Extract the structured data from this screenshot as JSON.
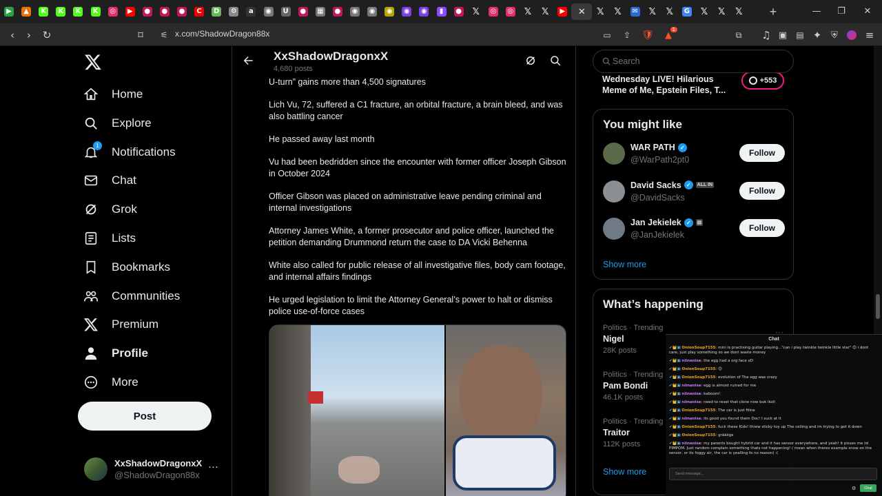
{
  "browser": {
    "url": "x.com/ShadowDragon88x",
    "tabs": [
      {
        "name": "tab-play",
        "glyph": "▶",
        "color": "#2ea043"
      },
      {
        "name": "tab-drive",
        "glyph": "▲",
        "color": "#e8710a"
      },
      {
        "name": "tab-kick-1",
        "glyph": "K",
        "color": "#53fc18"
      },
      {
        "name": "tab-kick-2",
        "glyph": "K",
        "color": "#53fc18"
      },
      {
        "name": "tab-kick-3",
        "glyph": "K",
        "color": "#53fc18"
      },
      {
        "name": "tab-kick-4",
        "glyph": "K",
        "color": "#53fc18"
      },
      {
        "name": "tab-instagram-1",
        "glyph": "◎",
        "color": "#e1306c"
      },
      {
        "name": "tab-youtube-1",
        "glyph": "▶",
        "color": "#ff0000"
      },
      {
        "name": "tab-red-1",
        "glyph": "●",
        "color": "#c2185b"
      },
      {
        "name": "tab-red-2",
        "glyph": "●",
        "color": "#c2185b"
      },
      {
        "name": "tab-red-3",
        "glyph": "●",
        "color": "#c2185b"
      },
      {
        "name": "tab-red-4",
        "glyph": "C",
        "color": "#e00"
      },
      {
        "name": "tab-yellow",
        "glyph": "D",
        "color": "#6b5"
      },
      {
        "name": "tab-grey-1",
        "glyph": "⚙",
        "color": "#888"
      },
      {
        "name": "tab-amazon",
        "glyph": "a",
        "color": "#333"
      },
      {
        "name": "tab-grey-2",
        "glyph": "◉",
        "color": "#777"
      },
      {
        "name": "tab-grey-3",
        "glyph": "U",
        "color": "#666"
      },
      {
        "name": "tab-red-5",
        "glyph": "●",
        "color": "#c2185b"
      },
      {
        "name": "tab-grey-4",
        "glyph": "▦",
        "color": "#777"
      },
      {
        "name": "tab-red-6",
        "glyph": "●",
        "color": "#c2185b"
      },
      {
        "name": "tab-grey-5",
        "glyph": "◉",
        "color": "#777"
      },
      {
        "name": "tab-grey-6",
        "glyph": "◉",
        "color": "#777"
      },
      {
        "name": "tab-yellow-2",
        "glyph": "◉",
        "color": "#b8a400"
      },
      {
        "name": "tab-purple-1",
        "glyph": "◉",
        "color": "#7b3fe4"
      },
      {
        "name": "tab-purple-2",
        "glyph": "◉",
        "color": "#7b3fe4"
      },
      {
        "name": "tab-twitch",
        "glyph": "▮",
        "color": "#9146ff"
      },
      {
        "name": "tab-red-7",
        "glyph": "●",
        "color": "#c2185b"
      },
      {
        "name": "tab-x-1",
        "glyph": "𝕏",
        "color": "x"
      },
      {
        "name": "tab-instagram-2",
        "glyph": "◎",
        "color": "#e1306c"
      },
      {
        "name": "tab-instagram-3",
        "glyph": "◎",
        "color": "#e1306c"
      },
      {
        "name": "tab-x-2",
        "glyph": "𝕏",
        "color": "x"
      },
      {
        "name": "tab-x-3",
        "glyph": "𝕏",
        "color": "x"
      },
      {
        "name": "tab-youtube-2",
        "glyph": "▶",
        "color": "#ff0000"
      },
      {
        "name": "tab-x-active",
        "glyph": "✕",
        "color": "x",
        "active": true
      },
      {
        "name": "tab-x-4",
        "glyph": "𝕏",
        "color": "x"
      },
      {
        "name": "tab-x-5",
        "glyph": "𝕏",
        "color": "x"
      },
      {
        "name": "tab-mail",
        "glyph": "✉",
        "color": "#2b6cd4"
      },
      {
        "name": "tab-x-6",
        "glyph": "𝕏",
        "color": "x"
      },
      {
        "name": "tab-x-7",
        "glyph": "𝕏",
        "color": "x"
      },
      {
        "name": "tab-google",
        "glyph": "G",
        "color": "#4285f4"
      },
      {
        "name": "tab-x-8",
        "glyph": "𝕏",
        "color": "x"
      },
      {
        "name": "tab-x-9",
        "glyph": "𝕏",
        "color": "x"
      },
      {
        "name": "tab-x-10",
        "glyph": "𝕏",
        "color": "x"
      }
    ],
    "new_tab": "+",
    "brave_badge": "1"
  },
  "nav": {
    "items": [
      {
        "name": "nav-home",
        "label": "Home",
        "icon": "home-icon"
      },
      {
        "name": "nav-explore",
        "label": "Explore",
        "icon": "search-icon"
      },
      {
        "name": "nav-notifications",
        "label": "Notifications",
        "icon": "bell-icon",
        "badge": "1"
      },
      {
        "name": "nav-chat",
        "label": "Chat",
        "icon": "mail-icon"
      },
      {
        "name": "nav-grok",
        "label": "Grok",
        "icon": "grok-icon"
      },
      {
        "name": "nav-lists",
        "label": "Lists",
        "icon": "list-icon"
      },
      {
        "name": "nav-bookmarks",
        "label": "Bookmarks",
        "icon": "bookmark-icon"
      },
      {
        "name": "nav-communities",
        "label": "Communities",
        "icon": "people-icon"
      },
      {
        "name": "nav-premium",
        "label": "Premium",
        "icon": "x-icon"
      },
      {
        "name": "nav-profile",
        "label": "Profile",
        "icon": "person-icon",
        "bold": true
      },
      {
        "name": "nav-more",
        "label": "More",
        "icon": "more-circle-icon"
      }
    ],
    "post_label": "Post",
    "profile": {
      "name": "XxShadowDragonxX",
      "handle": "@ShadowDragon88x",
      "more": "···"
    }
  },
  "header": {
    "title": "XxShadowDragonxX",
    "count": "4,680 posts"
  },
  "post": {
    "paragraphs": [
      "U-turn” gains more than 4,500 signatures",
      "Lich Vu, 72, suffered a C1 fracture, an orbital fracture, a brain bleed, and was also battling cancer",
      "He passed away last month",
      "Vu had been bedridden since the encounter with former officer Joseph Gibson in October 2024",
      "Officer Gibson was placed on administrative leave pending criminal and internal investigations",
      "Attorney James White, a former prosecutor and police officer, launched the petition demanding Drummond return the case to DA Vicki Behenna",
      "White also called for public release of all investigative files, body cam footage, and internal affairs findings",
      "He urged legislation to limit the Attorney General’s power to halt or dismiss police use-of-force cases"
    ]
  },
  "right": {
    "search_placeholder": "Search",
    "spaces_title": "Wednesday LIVE! Hilarious Meme of Me, Epstein Files, T...",
    "spaces_count": "+553",
    "might_like_title": "You might like",
    "suggestions": [
      {
        "name": "WAR PATH",
        "handle": "@WarPath2pt0",
        "follow": "Follow",
        "avatar": "#5a6a4a",
        "tag": ""
      },
      {
        "name": "David Sacks",
        "handle": "@DavidSacks",
        "follow": "Follow",
        "avatar": "#8a8f94",
        "tag": "ALL IN"
      },
      {
        "name": "Jan Jekielek",
        "handle": "@JanJekielek",
        "follow": "Follow",
        "avatar": "#6f7a86",
        "tag": "▤"
      }
    ],
    "show_more_1": "Show more",
    "happening_title": "What’s happening",
    "trends": [
      {
        "meta": "Politics · Trending",
        "name": "Nigel",
        "posts": "28K posts"
      },
      {
        "meta": "Politics · Trending",
        "name": "Pam Bondi",
        "posts": "46.1K posts"
      },
      {
        "meta": "Politics · Trending",
        "name": "Traitor",
        "posts": "112K posts"
      }
    ],
    "trend_more": "···",
    "show_more_2": "Show more"
  },
  "chat": {
    "title": "Chat",
    "messages": [
      {
        "user": "OnionSoup7155",
        "cls": "u1",
        "text": ": mini is practising guitar playing...\"can i play twinkle twinkle little star\" 😊 i dont care, just play something so we dont waste money"
      },
      {
        "user": "niinanise",
        "cls": "u2",
        "text": ": the egg had a org face xD"
      },
      {
        "user": "OnionSoup7155",
        "cls": "u1",
        "text": ": 😊"
      },
      {
        "user": "OnionSoup7155",
        "cls": "u1",
        "text": ": evolution of The egg was crazy"
      },
      {
        "user": "niinanise",
        "cls": "u2",
        "text": ": egg is almost ruined for me"
      },
      {
        "user": "niinanise",
        "cls": "u2",
        "text": ": kaboom!"
      },
      {
        "user": "niinanise",
        "cls": "u2",
        "text": ": need to reset that clone now buk lkoll"
      },
      {
        "user": "OnionSoup7155",
        "cls": "u1",
        "text": ": The car is just fiiine"
      },
      {
        "user": "niinanise",
        "cls": "u2",
        "text": ": its good you found them Doc! I suck at it"
      },
      {
        "user": "OnionSoup7155",
        "cls": "u1",
        "text": ": fuck these Kids! threw sticky toy up The ceiling and im trying to get it down"
      },
      {
        "user": "OnionSoup7155",
        "cls": "u1",
        "text": ": grääiige"
      },
      {
        "user": "niinanise",
        "cls": "u2",
        "text": ": my parents bought hybrid car and it has sensor everywhere, and yeah! it pisses me lol PIMPOM. Just random complain something thats not happening! ( mean when theres example snow on the sensor, or its foggy air, the car is yealling fo no reason) :("
      }
    ],
    "placeholder": "Send message...",
    "send_label": "Chat"
  }
}
